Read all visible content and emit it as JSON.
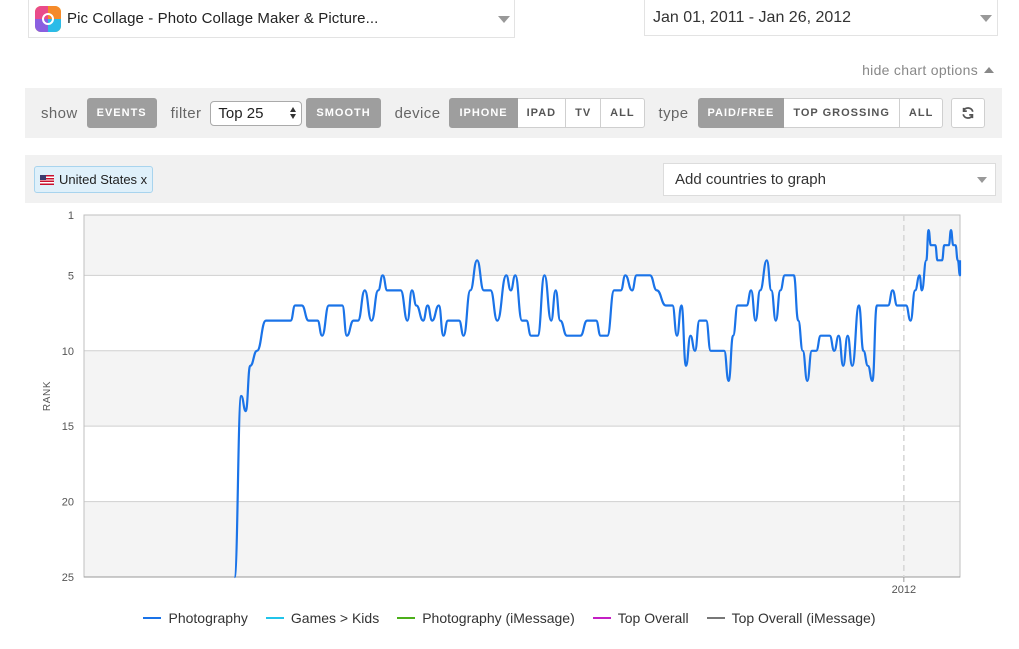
{
  "app_selector": {
    "name": "Pic Collage - Photo Collage Maker & Picture..."
  },
  "date_selector": {
    "range": "Jan 01, 2011 - Jan 26, 2012"
  },
  "chart_options": {
    "toggle_label": "hide chart options"
  },
  "options_bar": {
    "show_label": "show",
    "events_label": "EVENTS",
    "filter_label": "filter",
    "filter_value": "Top 25",
    "smooth_label": "SMOOTH",
    "device_label": "device",
    "device_options": [
      "IPHONE",
      "IPAD",
      "TV",
      "ALL"
    ],
    "device_selected": "IPHONE",
    "type_label": "type",
    "type_options": [
      "PAID/FREE",
      "TOP GROSSING",
      "ALL"
    ],
    "type_selected": "PAID/FREE"
  },
  "countries": {
    "selected_tag": "United States x",
    "add_placeholder": "Add countries to graph"
  },
  "colors": {
    "photography": "#1a73e8",
    "games_kids": "#21c4ea",
    "photography_imessage": "#4caf1a",
    "top_overall": "#c41fc4",
    "top_overall_imessage": "#777777",
    "active_pill": "#9e9e9e"
  },
  "icons": {
    "app": "pic-collage-app-icon",
    "refresh": "refresh-icon",
    "flag": "us-flag-icon"
  },
  "chart_data": {
    "type": "line",
    "ylabel": "RANK",
    "y_inverted": true,
    "ylim": [
      1,
      25
    ],
    "yticks": [
      1,
      5,
      10,
      15,
      20,
      25
    ],
    "xlim": [
      "2011-01-01",
      "2012-01-26"
    ],
    "xticks": [
      {
        "date": "2012-01-01",
        "label": "2012"
      }
    ],
    "grid": true,
    "legend_position": "bottom",
    "series": [
      {
        "name": "Photography",
        "color": "#1a73e8",
        "points": [
          [
            "2011-03-09",
            25
          ],
          [
            "2011-03-12",
            13
          ],
          [
            "2011-03-14",
            14
          ],
          [
            "2011-03-16",
            11
          ],
          [
            "2011-03-19",
            10
          ],
          [
            "2011-03-23",
            8
          ],
          [
            "2011-03-29",
            8
          ],
          [
            "2011-04-03",
            8
          ],
          [
            "2011-04-05",
            7
          ],
          [
            "2011-04-08",
            7
          ],
          [
            "2011-04-11",
            8
          ],
          [
            "2011-04-15",
            8
          ],
          [
            "2011-04-17",
            9
          ],
          [
            "2011-04-20",
            7
          ],
          [
            "2011-04-26",
            7
          ],
          [
            "2011-04-28",
            9
          ],
          [
            "2011-05-01",
            8
          ],
          [
            "2011-05-03",
            8
          ],
          [
            "2011-05-06",
            6
          ],
          [
            "2011-05-09",
            8
          ],
          [
            "2011-05-12",
            6
          ],
          [
            "2011-05-14",
            5
          ],
          [
            "2011-05-16",
            6
          ],
          [
            "2011-05-22",
            6
          ],
          [
            "2011-05-25",
            8
          ],
          [
            "2011-05-27",
            6
          ],
          [
            "2011-05-29",
            7
          ],
          [
            "2011-06-01",
            8
          ],
          [
            "2011-06-03",
            7
          ],
          [
            "2011-06-05",
            8
          ],
          [
            "2011-06-08",
            7
          ],
          [
            "2011-06-10",
            9
          ],
          [
            "2011-06-12",
            8
          ],
          [
            "2011-06-17",
            8
          ],
          [
            "2011-06-19",
            9
          ],
          [
            "2011-06-22",
            6
          ],
          [
            "2011-06-25",
            4
          ],
          [
            "2011-06-28",
            6
          ],
          [
            "2011-07-01",
            6
          ],
          [
            "2011-07-04",
            8
          ],
          [
            "2011-07-08",
            5
          ],
          [
            "2011-07-10",
            6
          ],
          [
            "2011-07-12",
            5
          ],
          [
            "2011-07-15",
            8
          ],
          [
            "2011-07-17",
            8
          ],
          [
            "2011-07-19",
            9
          ],
          [
            "2011-07-22",
            9
          ],
          [
            "2011-07-25",
            5
          ],
          [
            "2011-07-28",
            8
          ],
          [
            "2011-07-30",
            6
          ],
          [
            "2011-08-01",
            8
          ],
          [
            "2011-08-04",
            9
          ],
          [
            "2011-08-10",
            9
          ],
          [
            "2011-08-13",
            8
          ],
          [
            "2011-08-17",
            8
          ],
          [
            "2011-08-19",
            9
          ],
          [
            "2011-08-22",
            9
          ],
          [
            "2011-08-25",
            6
          ],
          [
            "2011-08-28",
            6
          ],
          [
            "2011-08-30",
            5
          ],
          [
            "2011-09-02",
            6
          ],
          [
            "2011-09-04",
            5
          ],
          [
            "2011-09-10",
            5
          ],
          [
            "2011-09-13",
            6
          ],
          [
            "2011-09-17",
            7
          ],
          [
            "2011-09-20",
            7
          ],
          [
            "2011-09-22",
            9
          ],
          [
            "2011-09-24",
            7
          ],
          [
            "2011-09-26",
            11
          ],
          [
            "2011-09-28",
            9
          ],
          [
            "2011-09-30",
            10
          ],
          [
            "2011-10-02",
            8
          ],
          [
            "2011-10-05",
            8
          ],
          [
            "2011-10-07",
            10
          ],
          [
            "2011-10-13",
            10
          ],
          [
            "2011-10-15",
            12
          ],
          [
            "2011-10-17",
            9
          ],
          [
            "2011-10-19",
            7
          ],
          [
            "2011-10-23",
            7
          ],
          [
            "2011-10-25",
            6
          ],
          [
            "2011-10-27",
            8
          ],
          [
            "2011-10-29",
            6
          ],
          [
            "2011-11-01",
            4
          ],
          [
            "2011-11-03",
            6
          ],
          [
            "2011-11-05",
            8
          ],
          [
            "2011-11-07",
            6
          ],
          [
            "2011-11-09",
            5
          ],
          [
            "2011-11-13",
            5
          ],
          [
            "2011-11-15",
            8
          ],
          [
            "2011-11-17",
            10
          ],
          [
            "2011-11-19",
            12
          ],
          [
            "2011-11-21",
            10
          ],
          [
            "2011-11-23",
            10
          ],
          [
            "2011-11-25",
            9
          ],
          [
            "2011-11-29",
            9
          ],
          [
            "2011-12-01",
            10
          ],
          [
            "2011-12-03",
            9
          ],
          [
            "2011-12-05",
            11
          ],
          [
            "2011-12-07",
            9
          ],
          [
            "2011-12-09",
            11
          ],
          [
            "2011-12-12",
            7
          ],
          [
            "2011-12-14",
            10
          ],
          [
            "2011-12-16",
            11
          ],
          [
            "2011-12-18",
            12
          ],
          [
            "2011-12-20",
            7
          ],
          [
            "2011-12-25",
            7
          ],
          [
            "2011-12-27",
            6
          ],
          [
            "2011-12-29",
            7
          ],
          [
            "2012-01-02",
            7
          ],
          [
            "2012-01-04",
            8
          ],
          [
            "2012-01-06",
            6
          ],
          [
            "2012-01-08",
            5
          ],
          [
            "2012-01-09",
            6
          ],
          [
            "2012-01-11",
            4
          ],
          [
            "2012-01-12",
            2
          ],
          [
            "2012-01-13",
            3
          ],
          [
            "2012-01-15",
            3
          ],
          [
            "2012-01-16",
            4
          ],
          [
            "2012-01-18",
            4
          ],
          [
            "2012-01-19",
            3
          ],
          [
            "2012-01-21",
            3
          ],
          [
            "2012-01-22",
            2
          ],
          [
            "2012-01-23",
            3
          ],
          [
            "2012-01-24",
            3
          ],
          [
            "2012-01-25",
            4
          ],
          [
            "2012-01-26",
            5
          ],
          [
            "2012-01-26",
            4
          ]
        ]
      }
    ],
    "legend": [
      {
        "name": "Photography",
        "color": "#1a73e8"
      },
      {
        "name": "Games > Kids",
        "color": "#21c4ea"
      },
      {
        "name": "Photography (iMessage)",
        "color": "#4caf1a"
      },
      {
        "name": "Top Overall",
        "color": "#c41fc4"
      },
      {
        "name": "Top Overall (iMessage)",
        "color": "#777777"
      }
    ]
  }
}
